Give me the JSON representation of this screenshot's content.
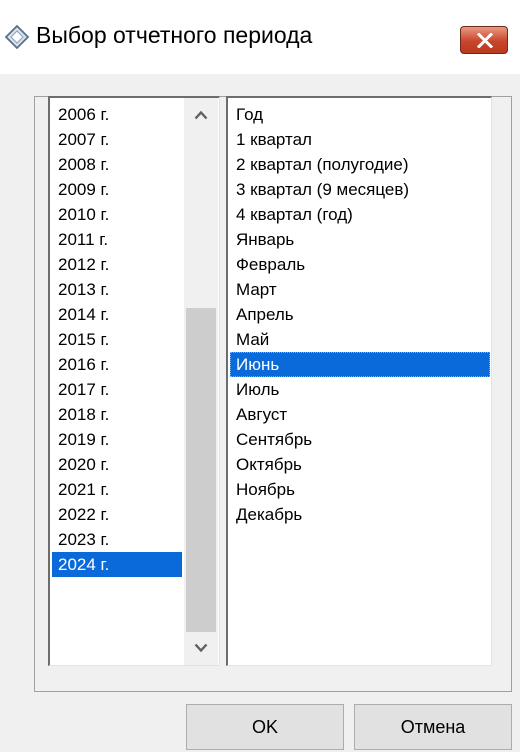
{
  "window": {
    "title": "Выбор отчетного периода",
    "close_icon": "close-icon",
    "app_icon": "diamond-icon"
  },
  "years": {
    "items": [
      "2006 г.",
      "2007 г.",
      "2008 г.",
      "2009 г.",
      "2010 г.",
      "2011 г.",
      "2012 г.",
      "2013 г.",
      "2014 г.",
      "2015 г.",
      "2016 г.",
      "2017 г.",
      "2018 г.",
      "2019 г.",
      "2020 г.",
      "2021 г.",
      "2022 г.",
      "2023 г.",
      "2024 г."
    ],
    "selected": "2024 г."
  },
  "periods": {
    "items": [
      "Год",
      "1 квартал",
      "2 квартал (полугодие)",
      "3 квартал (9 месяцев)",
      "4 квартал (год)",
      "Январь",
      "Февраль",
      "Март",
      "Апрель",
      "Май",
      "Июнь",
      "Июль",
      "Август",
      "Сентябрь",
      "Октябрь",
      "Ноябрь",
      "Декабрь"
    ],
    "selected": "Июнь"
  },
  "buttons": {
    "ok": "OK",
    "cancel": "Отмена"
  },
  "colors": {
    "selection": "#0a6ad9",
    "close_button": "#c8452a",
    "dialog_background": "#f0f0f0"
  }
}
